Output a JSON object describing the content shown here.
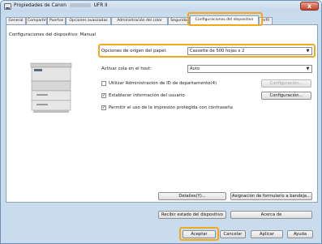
{
  "window": {
    "title_prefix": "Propiedades de Canon",
    "title_suffix": "UFR II",
    "close_glyph": "x"
  },
  "tabs": [
    {
      "label": "General"
    },
    {
      "label": "Compartir"
    },
    {
      "label": "Puertos"
    },
    {
      "label": "Opciones avanzadas"
    },
    {
      "label": "Administración del color"
    },
    {
      "label": "Segurida"
    },
    {
      "label": "Configuraciones del dispositivo"
    },
    {
      "label": "erfil"
    }
  ],
  "panel": {
    "header": "Configuraciones del dispositivo: Manual"
  },
  "settings": {
    "paper_source_label": "Opciones de origen del papel:",
    "paper_source_value": "Cassette de 500 hojas x 2",
    "hold_queue_label": "Activar cola en el host:",
    "hold_queue_value": "Auto",
    "dept_id_label": "Utilizar Administración de ID de departamento(4)",
    "dept_id_checked": false,
    "dept_config_button": "Configuración...",
    "user_info_label": "Establecer información del usuario",
    "user_info_checked": true,
    "user_config_button": "Configuración...",
    "secure_print_label": "Permitir el uso de la impresión protegida con contraseña",
    "secure_print_checked": true
  },
  "panel_buttons": {
    "details": "Detalles(Y)...",
    "form_assign": "Asignación de formulario a bandeja...",
    "get_status": "Recibir estado del dispositivo",
    "about": "Acerca de"
  },
  "dialog_buttons": {
    "ok": "Aceptar",
    "cancel": "Cancelar",
    "apply": "Aplicar",
    "help": "Ayuda"
  },
  "icons": {
    "dropdown": "▼",
    "check": "✓"
  },
  "colors": {
    "highlight": "#f4a81d",
    "window_frame": "#c9dcee"
  }
}
